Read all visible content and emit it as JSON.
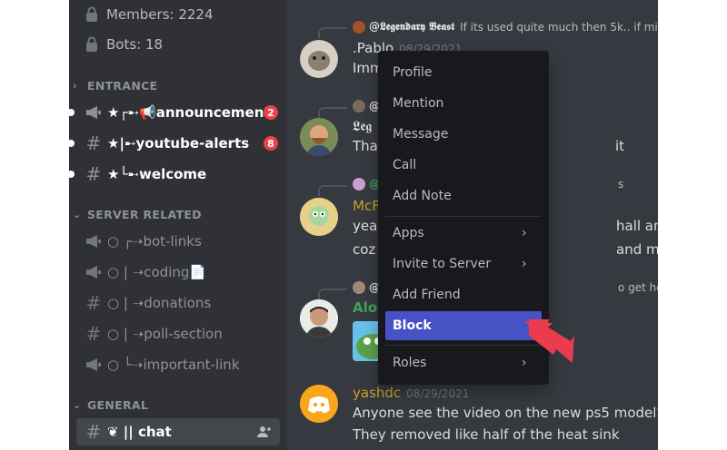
{
  "server_stats": {
    "members": "Members: 2224",
    "bots": "Bots: 18"
  },
  "categories": {
    "entrance": "ENTRANCE",
    "server_related": "SERVER RELATED",
    "general": "GENERAL"
  },
  "channels": {
    "announcement": {
      "name": "★┌➸📢announcement",
      "badge": "2"
    },
    "youtube_alerts": {
      "name": "★|➸youtube-alerts",
      "badge": "8"
    },
    "welcome": {
      "name": "★└➸welcome"
    },
    "bot_links": {
      "name": "○ ┌➝bot-links"
    },
    "coding": {
      "name": "○ | ➝coding📄"
    },
    "donations": {
      "name": "○ | ➝donations"
    },
    "poll_section": {
      "name": "○ | ➝poll-section"
    },
    "important_link": {
      "name": "○ └➝important-link"
    },
    "chat": {
      "name": "❦ || chat"
    }
  },
  "messages": [
    {
      "reply_name": "@𝕷𝖊𝖌𝖊𝖓𝖉𝖆𝖗𝖞 𝕭𝖊𝖆𝖘𝖙",
      "reply_text": "If its used quite much then 5k.. if mi",
      "username": ".Pablo",
      "timestamp": "08/29/2021",
      "lines": [
        "Imm"
      ]
    },
    {
      "reply_name": "@",
      "reply_text": "",
      "username": "𝕷𝖊𝖌",
      "timestamp": "",
      "lines": [
        "That",
        "it"
      ]
    },
    {
      "reply_name": "@",
      "reply_text": "s",
      "username": "McF",
      "timestamp": "",
      "lines": [
        "yeah",
        "hall and later after",
        "coz p",
        "and making jet eng"
      ]
    },
    {
      "reply_name": "@",
      "reply_text": "o get heated and ma",
      "username": "Aloo",
      "timestamp": "",
      "lines": []
    },
    {
      "reply_name": "",
      "reply_text": "",
      "username": "yashdc",
      "timestamp": "08/29/2021",
      "lines": [
        "Anyone see the video on the new ps5 model?",
        "They removed like half of the heat sink"
      ]
    }
  ],
  "context_menu": {
    "profile": "Profile",
    "mention": "Mention",
    "message": "Message",
    "call": "Call",
    "add_note": "Add Note",
    "apps": "Apps",
    "invite_to_server": "Invite to Server",
    "add_friend": "Add Friend",
    "block": "Block",
    "roles": "Roles"
  },
  "colors": {
    "accent_block": "#4752c4",
    "badge": "#ed4245",
    "arrow": "#ea3c4e",
    "green_name": "#3ba55d",
    "gold_name": "#c9a227"
  }
}
